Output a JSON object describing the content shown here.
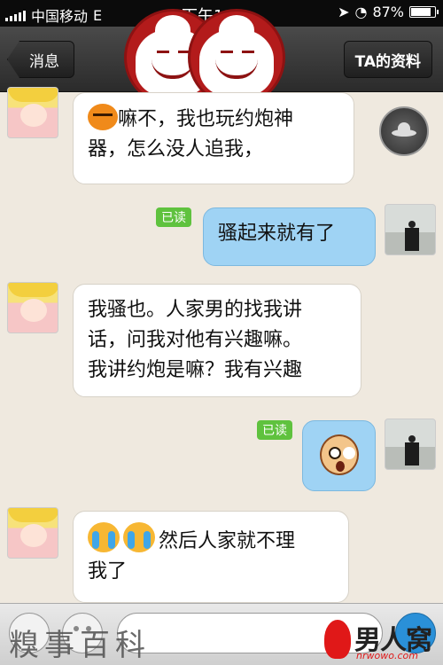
{
  "statusbar": {
    "carrier": "中国移动",
    "network": "E",
    "time": "下午1:21",
    "battery_percent": "87%",
    "battery_level": 0.87
  },
  "navbar": {
    "back_label": "消息",
    "profile_label": "TA的资料"
  },
  "messages": [
    {
      "side": "in",
      "read": "",
      "emoji": "angry-face-icon",
      "text": "嘛不，我也玩约炮神器，怎么没人追我，",
      "lines": [
        "嘛不，我也玩约炮神",
        "器，怎么没人追我，"
      ]
    },
    {
      "side": "out",
      "read": "已读",
      "text": "骚起来就有了"
    },
    {
      "side": "in",
      "read": "",
      "text": "我骚也。人家男的找我讲话，问我对他有兴趣嘛。我讲约炮是嘛？我有兴趣",
      "lines": [
        "我骚也。人家男的找我讲",
        "话，问我对他有兴趣嘛。",
        "我讲约炮是嘛？我有兴趣"
      ]
    },
    {
      "side": "out",
      "read": "已读",
      "emoji": "surprised-face-icon",
      "text": ""
    },
    {
      "side": "in",
      "read": "",
      "emoji": "crying-face-icon",
      "text": "然后人家就不理我了",
      "lines": [
        "然后人家就不理",
        "我了"
      ]
    }
  ],
  "watermarks": {
    "left_text": "糗事百科",
    "right_text": "男人窝",
    "right_url": "nrwowo.com"
  },
  "colors": {
    "incoming_bubble": "#ffffff",
    "outgoing_bubble": "#9fd3f4",
    "read_badge": "#5fc23e",
    "logo_red": "#b31b1b"
  }
}
